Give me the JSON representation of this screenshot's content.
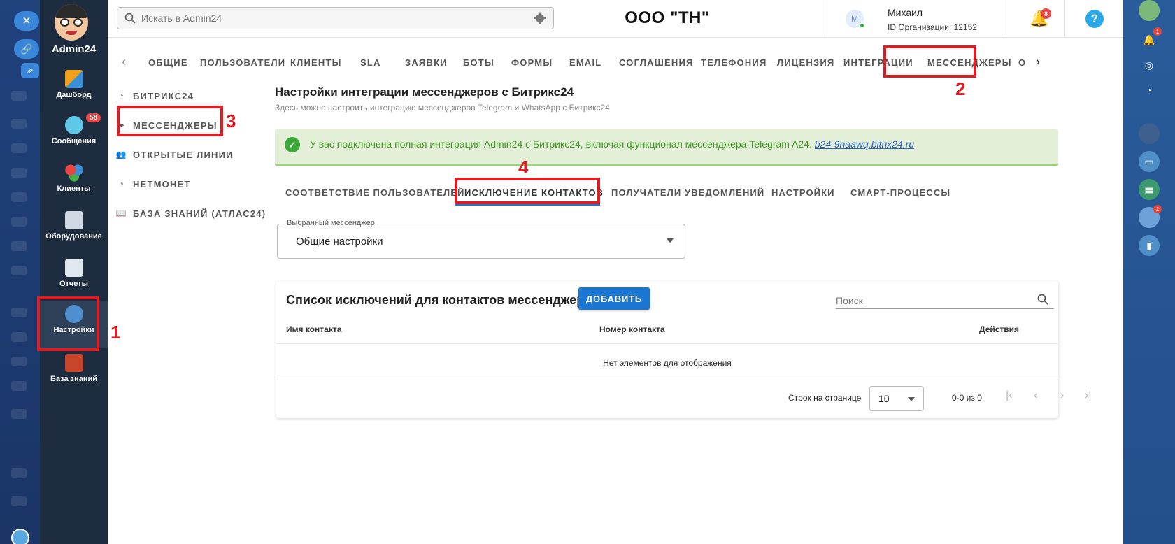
{
  "app": {
    "brand": "Admin24",
    "org_title": "ООО \"ТН\"",
    "search_placeholder": "Искать в Admin24"
  },
  "user": {
    "avatar_letter": "М",
    "name": "Михаил",
    "org_id": "ID Организации: 12152",
    "notifications": "8"
  },
  "sidebar": {
    "items": [
      {
        "label": "Дашборд",
        "icon": "dashboard-icon"
      },
      {
        "label": "Сообщения",
        "icon": "messages-icon",
        "badge": "58"
      },
      {
        "label": "Клиенты",
        "icon": "clients-icon"
      },
      {
        "label": "Оборудование",
        "icon": "equipment-icon"
      },
      {
        "label": "Отчеты",
        "icon": "reports-icon"
      },
      {
        "label": "Настройки",
        "icon": "settings-gear-icon"
      },
      {
        "label": "База знаний",
        "icon": "knowledge-base-icon"
      }
    ]
  },
  "top_tabs": [
    "ОБЩИЕ",
    "ПОЛЬЗОВАТЕЛИ",
    "КЛИЕНТЫ",
    "SLA",
    "ЗАЯВКИ",
    "БОТЫ",
    "ФОРМЫ",
    "EMAIL",
    "СОГЛАШЕНИЯ",
    "ТЕЛЕФОНИЯ",
    "ЛИЦЕНЗИЯ",
    "ИНТЕГРАЦИИ",
    "МЕССЕНДЖЕРЫ",
    "О"
  ],
  "sub_nav": [
    "БИТРИКС24",
    "МЕССЕНДЖЕРЫ",
    "ОТКРЫТЫЕ ЛИНИИ",
    "НЕТМОНЕТ",
    "БАЗА ЗНАНИЙ (АТЛАС24)"
  ],
  "content": {
    "title": "Настройки интеграции мессенджеров с Битрикс24",
    "subtitle": "Здесь можно настроить интеграцию мессенджеров Telegram и WhatsApp с Битрикс24",
    "alert_text": "У вас подключена полная интеграция Admin24 с Битрикс24, включая функционал мессенджера Telegram A24.",
    "alert_link": "b24-9naawq.bitrix24.ru",
    "subtabs": [
      "СООТВЕТСТВИЕ ПОЛЬЗОВАТЕЛЕЙ",
      "ИСКЛЮЧЕНИЕ КОНТАКТОВ",
      "ПОЛУЧАТЕЛИ УВЕДОМЛЕНИЙ",
      "НАСТРОЙКИ",
      "СМАРТ-ПРОЦЕССЫ"
    ],
    "active_subtab": "ИСКЛЮЧЕНИЕ КОНТАКТОВ",
    "select_label": "Выбранный мессенджер",
    "select_value": "Общие настройки"
  },
  "table": {
    "title": "Список исключений для контактов мессенджера",
    "add_button": "ДОБАВИТЬ",
    "search_placeholder": "Поиск",
    "columns": [
      "Имя контакта",
      "Номер контакта",
      "Действия"
    ],
    "empty_text": "Нет элементов для отображения",
    "rows_per_page_label": "Строк на странице",
    "rows_per_page": "10",
    "range": "0-0 из 0"
  },
  "annotations": [
    "1",
    "2",
    "3",
    "4"
  ],
  "colors": {
    "accent": "#1976d2",
    "annotation": "#e11b22",
    "sidebar_bg": "#1e2c3f",
    "success_bg": "#e3f0d7"
  }
}
